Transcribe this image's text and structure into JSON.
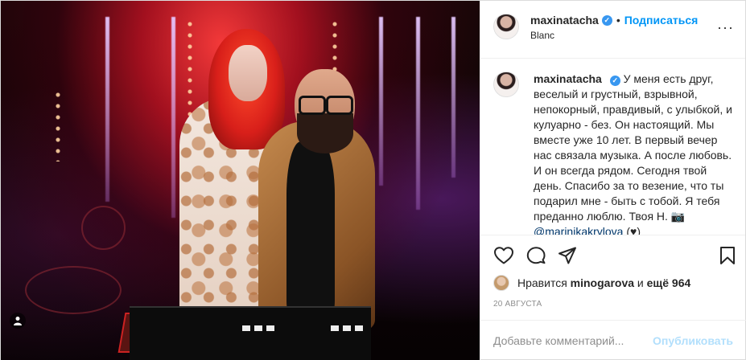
{
  "post": {
    "username": "maxinatacha",
    "follow_label": "Подписаться",
    "separator": "•",
    "location": "Blanc",
    "more_label": "···",
    "verified_mark": "✓",
    "caption": {
      "username": "maxinatacha",
      "text": "У меня есть друг, веселый и грустный, взрывной, непокорный, правдивый, с улыбкой, и кулуарно - без. Он настоящий. Мы вместе уже 10 лет. В первый вечер нас связала музыка. А после любовь. И он всегда рядом. Сегодня твой день. Спасибо за то везение, что ты подарил мне - быть с тобой. Я тебя преданно люблю. Твоя Н. 📷",
      "mention": "@marinikakrylova",
      "suffix": " (♥)"
    },
    "actions": {
      "like_icon": "heart-outline-icon",
      "comment_icon": "comment-bubble-icon",
      "share_icon": "paper-plane-icon",
      "save_icon": "bookmark-icon"
    },
    "likes": {
      "prefix": "Нравится ",
      "user": "minogarova",
      "joiner": " и ",
      "count": "ещё 964"
    },
    "date": "20 августа",
    "comment": {
      "placeholder": "Добавьте комментарий...",
      "publish_label": "Опубликовать"
    },
    "colors": {
      "accent": "#0095f6",
      "verified": "#3897f0",
      "publish_disabled": "#b2dffc",
      "muted": "#8e8e8e"
    }
  }
}
